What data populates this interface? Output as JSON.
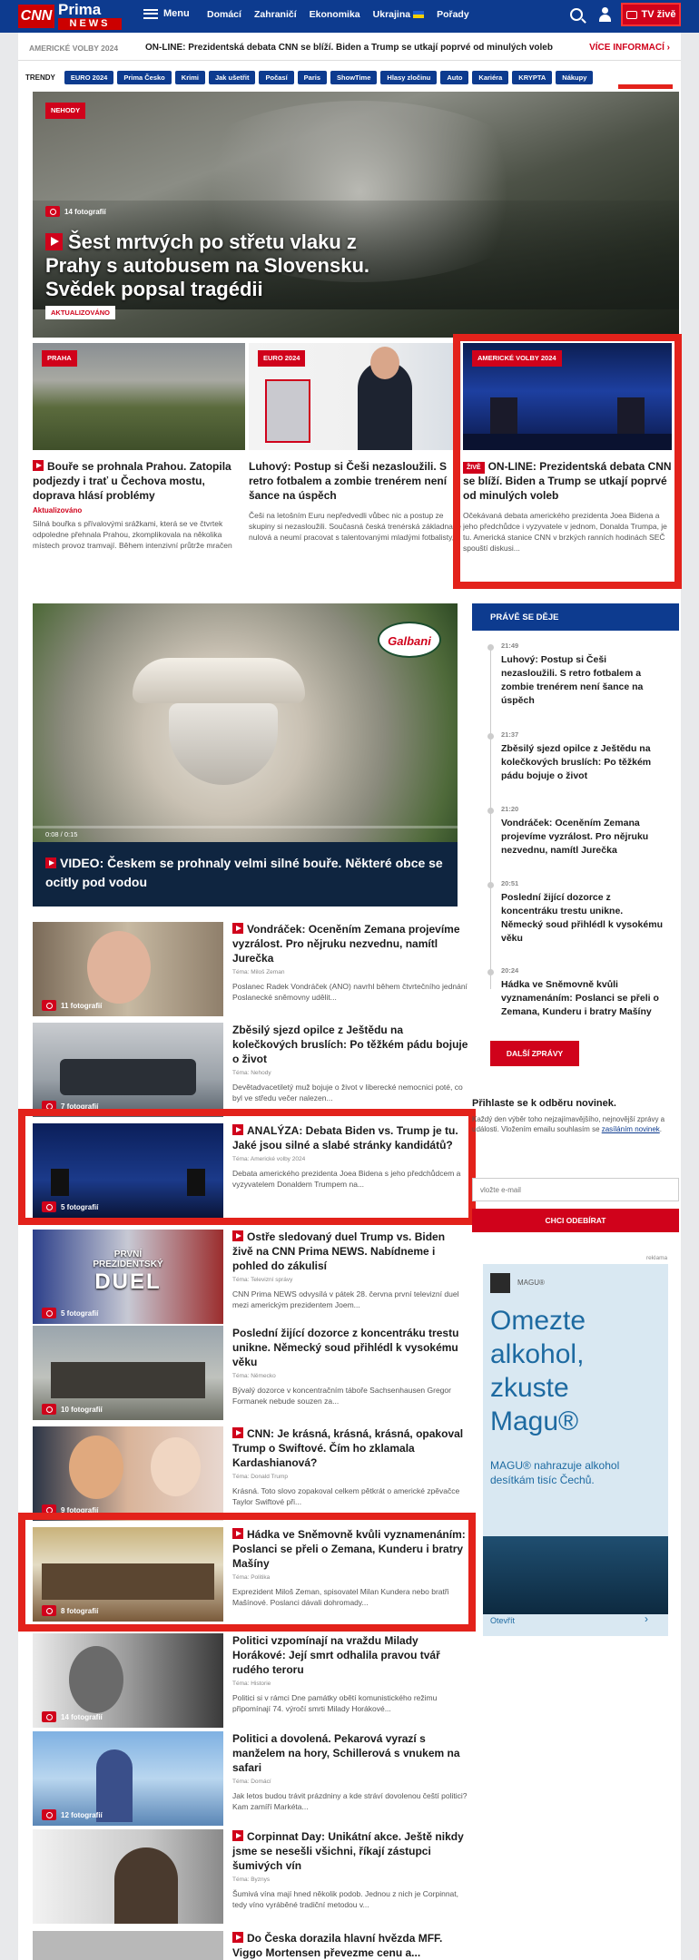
{
  "header": {
    "logo_cnn": "CNN",
    "logo_prima": "Prima",
    "logo_news": "NEWS",
    "menu": "Menu",
    "nav": [
      "Domácí",
      "Zahraničí",
      "Ekonomika",
      "Ukrajina",
      "Pořady"
    ],
    "tv_live": "TV živě"
  },
  "ticker": {
    "label": "AMERICKÉ VOLBY 2024",
    "text": "ON-LINE: Prezidentská debata CNN se blíží. Biden a Trump se utkají poprvé od minulých voleb",
    "more": "VÍCE INFORMACÍ ›"
  },
  "trends": {
    "label": "TRENDY",
    "items": [
      "EURO 2024",
      "Prima Česko",
      "Krimi",
      "Jak ušetřit",
      "Počasí",
      "Paris",
      "ShowTime",
      "Hlasy zločinu",
      "Auto",
      "Kariéra",
      "KRYPTA",
      "Nákupy"
    ]
  },
  "hero": {
    "badge": "NEHODY",
    "photos": "14 fotografií",
    "title": "Šest mrtvých po střetu vlaku z Prahy s autobusem na Slovensku. Svědek popsal tragédii",
    "updated": "AKTUALIZOVÁNO"
  },
  "cards": [
    {
      "badge": "PRAHA",
      "title": "Bouře se prohnala Prahou. Zatopila podjezdy i trať u Čechova mostu, doprava hlásí problémy",
      "updated": "Aktualizováno",
      "desc": "Silná bouřka s přívalovými srážkami, která se ve čtvrtek odpoledne přehnala Prahou, zkomplikovala na několika místech provoz tramvají. Během intenzivní průtrže mračen vod..."
    },
    {
      "badge": "EURO 2024",
      "title": "Luhový: Postup si Češi nezasloužili. S retro fotbalem a zombie trenérem není šance na úspěch",
      "desc": "Češi na letošním Euru nepředvedli vůbec nic a postup ze skupiny si nezasloužili. Současná česká trenérská základna je nulová a neumí pracovat s talentovanými mladými fotbalisty,..."
    },
    {
      "badge": "AMERICKÉ VOLBY 2024",
      "live": "ŽIVĚ",
      "title": "ON-LINE: Prezidentská debata CNN se blíží. Biden a Trump se utkají poprvé od minulých voleb",
      "desc": "Očekávaná debata amerického prezidenta Joea Bidena a jeho předchůdce i vyzyvatele v jednom, Donalda Trumpa, je tu. Americká stanice CNN v brzkých ranních hodinách SEČ spouští diskusi..."
    }
  ],
  "video": {
    "brand": "Galbani",
    "time": "0:08 / 0:15",
    "title": "VIDEO: Českem se prohnaly velmi silné bouře. Některé obce se ocitly pod vodou"
  },
  "sidebar": {
    "header": "PRÁVĚ SE DĚJE",
    "items": [
      {
        "time": "21:49",
        "title": "Luhový: Postup si Češi nezasloužili. S retro fotbalem a zombie trenérem není šance na úspěch"
      },
      {
        "time": "21:37",
        "title": "Zběsilý sjezd opilce z Ještědu na kolečkových bruslích: Po těžkém pádu bojuje o život"
      },
      {
        "time": "21:20",
        "title": "Vondráček: Oceněním Zemana projevíme vyzrálost. Pro nějruku nezvednu, namítl Jurečka"
      },
      {
        "time": "20:51",
        "title": "Poslední žijící dozorce z koncentráku trestu unikne. Německý soud přihlédl k vysokému věku"
      },
      {
        "time": "20:24",
        "title": "Hádka ve Sněmovně kvůli vyznamenáním: Poslanci se přeli o Zemana, Kunderu i bratry Mašíny"
      }
    ],
    "more": "DALŠÍ ZPRÁVY"
  },
  "articles": [
    {
      "photos": "11 fotografií",
      "title": "Vondráček: Oceněním Zemana projevíme vyzrálost. Pro nějruku nezvednu, namítl Jurečka",
      "tema": "Téma: Miloš Zeman",
      "desc": "Poslanec Radek Vondráček (ANO) navrhl během čtvrtečního jednání Poslanecké sněmovny udělit..."
    },
    {
      "photos": "7 fotografií",
      "title": "Zběsilý sjezd opilce z Ještědu na kolečkových bruslích: Po těžkém pádu bojuje o život",
      "tema": "Téma: Nehody",
      "desc": "Devětadvacetiletý muž bojuje o život v liberecké nemocnici poté, co byl ve středu večer nalezen..."
    },
    {
      "photos": "5 fotografií",
      "title": "ANALÝZA: Debata Biden vs. Trump je tu. Jaké jsou silné a slabé stránky kandidátů?",
      "tema": "Téma: Americké volby 2024",
      "desc": "Debata amerického prezidenta Joea Bidena s jeho předchůdcem a vyzyvatelem Donaldem Trumpem na..."
    },
    {
      "photos": "5 fotografií",
      "title": "Ostře sledovaný duel Trump vs. Biden živě na CNN Prima NEWS. Nabídneme i pohled do zákulisí",
      "tema": "Téma: Televizní správy",
      "desc": "CNN Prima NEWS odvysílá v pátek 28. června první televizní duel mezi americkým prezidentem Joem...",
      "duel1": "PRVNÍ",
      "duel2": "PREZIDENTSKÝ",
      "duel3": "DUEL"
    },
    {
      "photos": "10 fotografií",
      "title": "Poslední žijící dozorce z koncentráku trestu unikne. Německý soud přihlédl k vysokému věku",
      "tema": "Téma: Německo",
      "desc": "Bývalý dozorce v koncentračním táboře Sachsenhausen Gregor Formanek nebude souzen za..."
    },
    {
      "photos": "9 fotografií",
      "title": "CNN: Je krásná, krásná, krásná, opakoval Trump o Swiftové. Čím ho zklamala Kardashianová?",
      "tema": "Téma: Donald Trump",
      "desc": "Krásná. Toto slovo zopakoval celkem pětkrát o americké zpěvačce Taylor Swiftové při..."
    },
    {
      "photos": "8 fotografií",
      "title": "Hádka ve Sněmovně kvůli vyznamenáním: Poslanci se přeli o Zemana, Kunderu i bratry Mašíny",
      "tema": "Téma: Politika",
      "desc": "Exprezident Miloš Zeman, spisovatel Milan Kundera nebo bratři Mašínové. Poslanci dávali dohromady..."
    },
    {
      "photos": "14 fotografií",
      "title": "Politici vzpomínají na vraždu Milady Horákové: Její smrt odhalila pravou tvář rudého teroru",
      "tema": "Téma: Historie",
      "desc": "Politici si v rámci Dne památky obětí komunistického režimu připomínají 74. výročí smrti Milady Horákové..."
    },
    {
      "photos": "12 fotografií",
      "title": "Politici a dovolená. Pekarová vyrazí s manželem na hory, Schillerová s vnukem na safari",
      "tema": "Téma: Domácí",
      "desc": "Jak letos budou trávit prázdniny a kde stráví dovolenou čeští politici? Kam zamíří Markéta..."
    },
    {
      "photos": "",
      "title": "Corpinnat Day: Unikátní akce. Ještě nikdy jsme se nesešli všichni, říkají zástupci šumivých vín",
      "tema": "Téma: Byznys",
      "desc": "Šumivá vína mají hned několik podob. Jednou z nich je Corpinnat, tedy víno vyráběné tradiční metodou v..."
    },
    {
      "photos": "",
      "title": "Do Česka dorazila hlavní hvězda MFF. Viggo Mortensen převezme cenu a..."
    }
  ],
  "newsletter": {
    "title": "Přihlaste se k odběru novinek.",
    "desc_pre": "Každý den výběr toho nejzajímavějšího, nejnovější zprávy a události. Vložením emailu souhlasím se ",
    "desc_link": "zasíláním novinek",
    "desc_post": ".",
    "placeholder": "vložte e-mail",
    "button": "CHCI ODEBÍRAT"
  },
  "ad": {
    "label": "reklama",
    "brand": "MAGU®",
    "headline": "Omezte alkohol, zkuste Magu®",
    "text": "MAGU® nahrazuje alkohol desítkám tisíc Čechů.",
    "cta": "Otevřít",
    "arrow": "›"
  }
}
